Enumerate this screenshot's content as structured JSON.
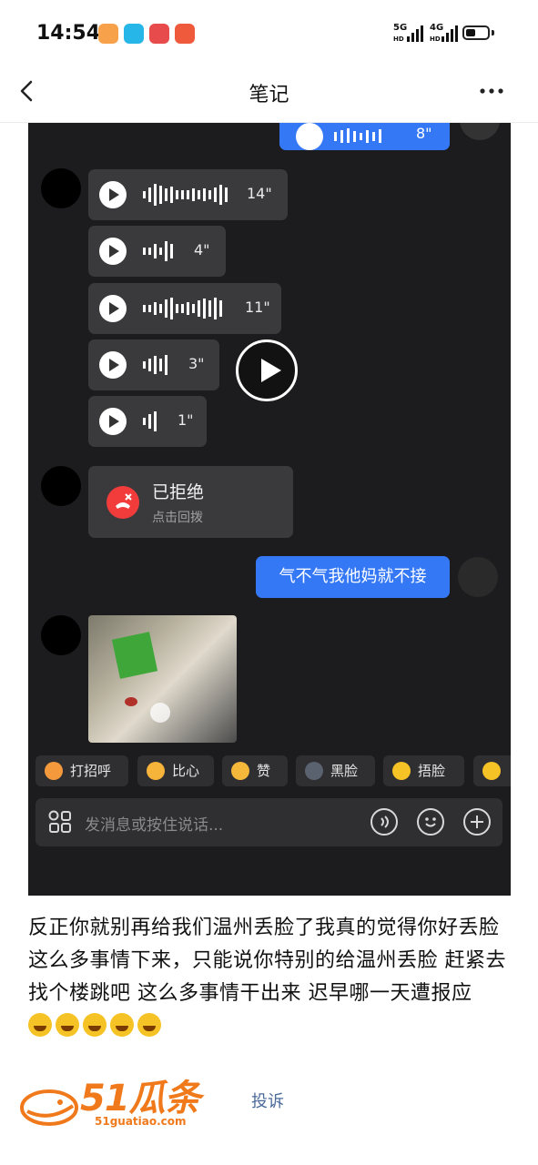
{
  "status_bar": {
    "time": "14:54",
    "network1": "5G",
    "network2": "4G",
    "sig_sub1": "HD",
    "sig_sub2": "HD"
  },
  "nav": {
    "title": "笔记",
    "back_icon": "chevron-left-icon",
    "more_icon": "more-dots-icon"
  },
  "chat": {
    "sent_voice_duration": "8\"",
    "voice_messages": [
      {
        "duration": "14\""
      },
      {
        "duration": "4\""
      },
      {
        "duration": "11\""
      },
      {
        "duration": "3\""
      },
      {
        "duration": "1\""
      }
    ],
    "call": {
      "title": "已拒绝",
      "subtitle": "点击回拨"
    },
    "my_message": "气不气我他妈就不接",
    "quick_replies": [
      "打招呼",
      "比心",
      "赞",
      "黑脸",
      "捂脸"
    ],
    "input_placeholder": "发消息或按住说话...",
    "colors": {
      "bubble_blue": "#3478f6",
      "chat_bg": "#1c1c1e",
      "reject_red": "#f23c3c"
    }
  },
  "post": {
    "text": "反正你就别再给我们温州丢脸了我真的觉得你好丢脸 这么多事情下来，只能说你特别的给温州丢脸 赶紧去找个楼跳吧 这么多事情干出来 迟早哪一天遭报应",
    "emoji_count": 5
  },
  "footer": {
    "logo_text": "51瓜条",
    "logo_url": "51guatiao.com",
    "report_label": "投诉",
    "brand_color": "#f07a1b"
  }
}
